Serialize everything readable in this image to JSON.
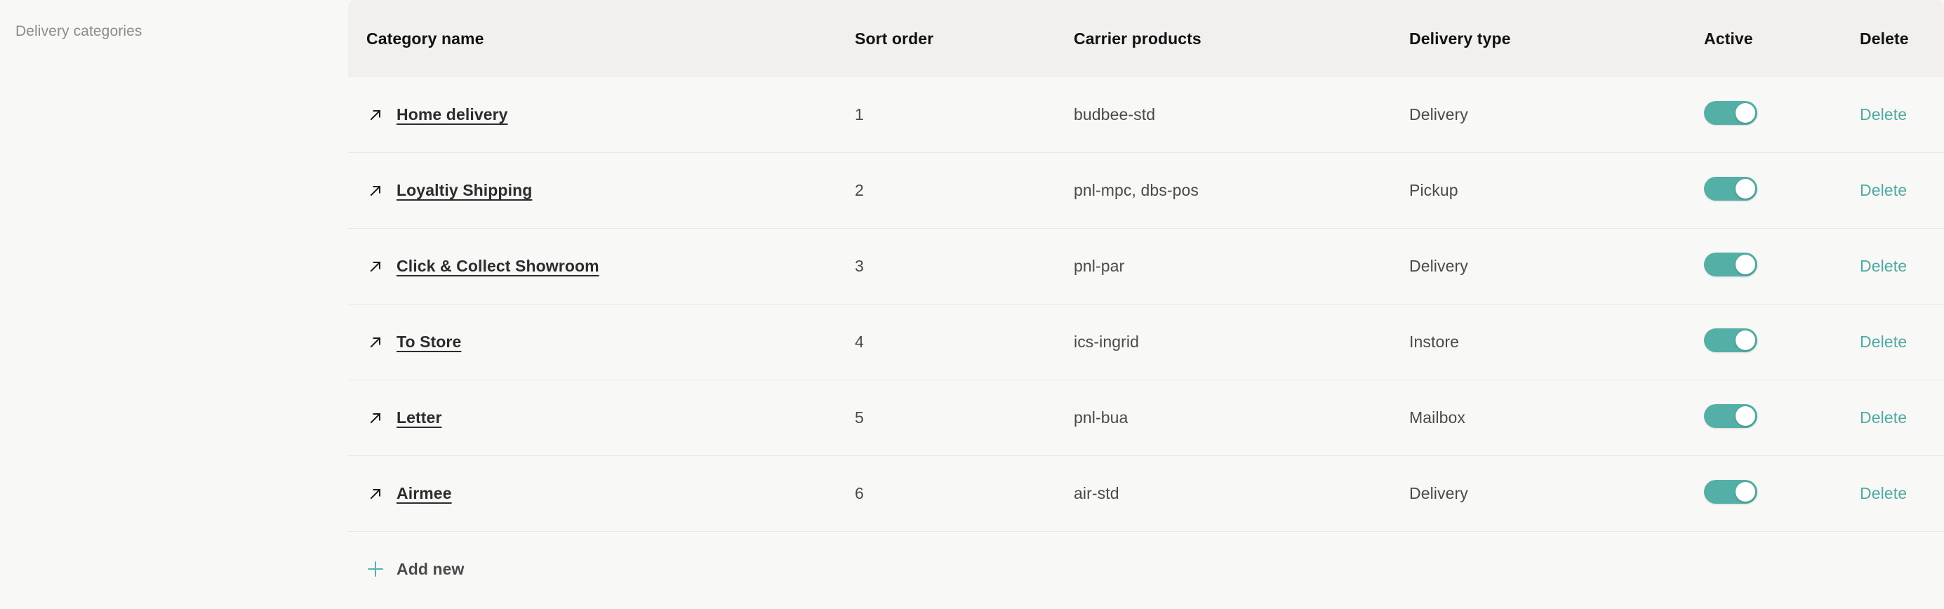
{
  "section": {
    "label": "Delivery categories"
  },
  "colors": {
    "accent_teal": "#4FA9A1",
    "toggle_on": "#54AFA7",
    "header_bg": "#F1F0EE",
    "page_bg": "#F8F8F7",
    "row_divider": "#E8E7E5",
    "label_gray": "#8C8C8C",
    "text_dark": "#2C2C2C",
    "text_body": "#4A4A4A"
  },
  "table": {
    "columns": [
      {
        "key": "name",
        "label": "Category name"
      },
      {
        "key": "sort",
        "label": "Sort order"
      },
      {
        "key": "carrier",
        "label": "Carrier products"
      },
      {
        "key": "type",
        "label": "Delivery type"
      },
      {
        "key": "active",
        "label": "Active"
      },
      {
        "key": "delete",
        "label": "Delete"
      }
    ],
    "rows": [
      {
        "name": "Home delivery",
        "sort": "1",
        "carrier": "budbee-std",
        "type": "Delivery",
        "active": true,
        "delete_label": "Delete",
        "link_icon": "arrow-up-right-icon"
      },
      {
        "name": "Loyaltiy Shipping",
        "sort": "2",
        "carrier": "pnl-mpc, dbs-pos",
        "type": "Pickup",
        "active": true,
        "delete_label": "Delete",
        "link_icon": "arrow-up-right-icon"
      },
      {
        "name": "Click & Collect Showroom",
        "sort": "3",
        "carrier": "pnl-par",
        "type": "Delivery",
        "active": true,
        "delete_label": "Delete",
        "link_icon": "arrow-up-right-icon"
      },
      {
        "name": "To Store",
        "sort": "4",
        "carrier": "ics-ingrid",
        "type": "Instore",
        "active": true,
        "delete_label": "Delete",
        "link_icon": "arrow-up-right-icon"
      },
      {
        "name": "Letter",
        "sort": "5",
        "carrier": "pnl-bua",
        "type": "Mailbox",
        "active": true,
        "delete_label": "Delete",
        "link_icon": "arrow-up-right-icon"
      },
      {
        "name": "Airmee",
        "sort": "6",
        "carrier": "air-std",
        "type": "Delivery",
        "active": true,
        "delete_label": "Delete",
        "link_icon": "arrow-up-right-icon"
      }
    ]
  },
  "add_new": {
    "label": "Add new",
    "icon": "plus-icon"
  }
}
